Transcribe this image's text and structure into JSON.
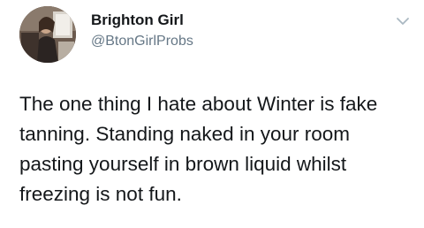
{
  "tweet": {
    "display_name": "Brighton Girl",
    "handle": "@BtonGirlProbs",
    "text": "The one thing I hate about Winter is fake tanning. Standing naked in your room pasting yourself in brown liquid whilst freezing is not fun.",
    "avatar_icon": "profile-photo",
    "menu_icon": "chevron-down-icon"
  },
  "colors": {
    "text": "#14171a",
    "secondary_text": "#657786",
    "icon": "#aab8c2",
    "background": "#ffffff"
  }
}
